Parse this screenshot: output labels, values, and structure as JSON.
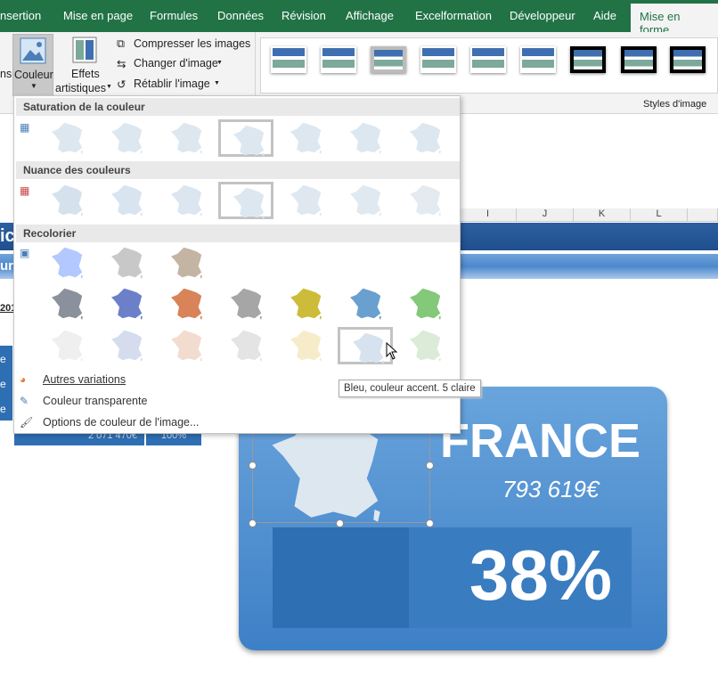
{
  "tabs": [
    "nsertion",
    "Mise en page",
    "Formules",
    "Données",
    "Révision",
    "Affichage",
    "Excelformation",
    "Développeur",
    "Aide",
    "Mise en forme"
  ],
  "ribbon": {
    "corrections_partial": "ns",
    "couleur": "Couleur",
    "effets": "Effets",
    "artistiques": "artistiques",
    "compresser": "Compresser les images",
    "changer": "Changer d'image",
    "retablir": "Rétablir l'image",
    "styles_label": "Styles d'image"
  },
  "sheet": {
    "columns": [
      "I",
      "J",
      "K",
      "L"
    ],
    "title_partial": "ic",
    "subtitle_partial": "ur",
    "year_partial": "201",
    "row_labels": [
      "e",
      "e",
      "e"
    ],
    "total_value": "2 071 470€",
    "total_pct": "100%"
  },
  "menu": {
    "sections": [
      "Saturation de la couleur",
      "Nuance des couleurs",
      "Recolorier"
    ],
    "saturation_colors": [
      "#dde7f0",
      "#dde7f0",
      "#dde7f0",
      "#dde7f0",
      "#dde7f0",
      "#dde7f0",
      "#dde7f0"
    ],
    "nuance_colors": [
      "#d5e2ee",
      "#d8e4ef",
      "#dbe6f0",
      "#dde7f0",
      "#dfe8f0",
      "#e1e9f0",
      "#e3eaf0"
    ],
    "recolor_row1": [
      "#b3c8ff",
      "#c8c8c8",
      "#c4b4a4"
    ],
    "recolor_row2": [
      "#8b919c",
      "#6b80c9",
      "#d88358",
      "#a6a6a6",
      "#cdbc3a",
      "#6aa0cf",
      "#84c87a"
    ],
    "recolor_row3": [
      "#efefef",
      "#d4dcee",
      "#f2dcd0",
      "#e4e4e4",
      "#f7ecc9",
      "#d6e3ef",
      "#dcebd7"
    ],
    "items": [
      "Autres variations",
      "Couleur transparente",
      "Options de couleur de l'image..."
    ]
  },
  "tooltip": "Bleu, couleur accent. 5 claire",
  "card": {
    "country": "FRANCE",
    "amount": "793 619€",
    "percent": "38%"
  },
  "colors": {
    "excel_green": "#217346",
    "card_blue": "#5b9bd5"
  }
}
